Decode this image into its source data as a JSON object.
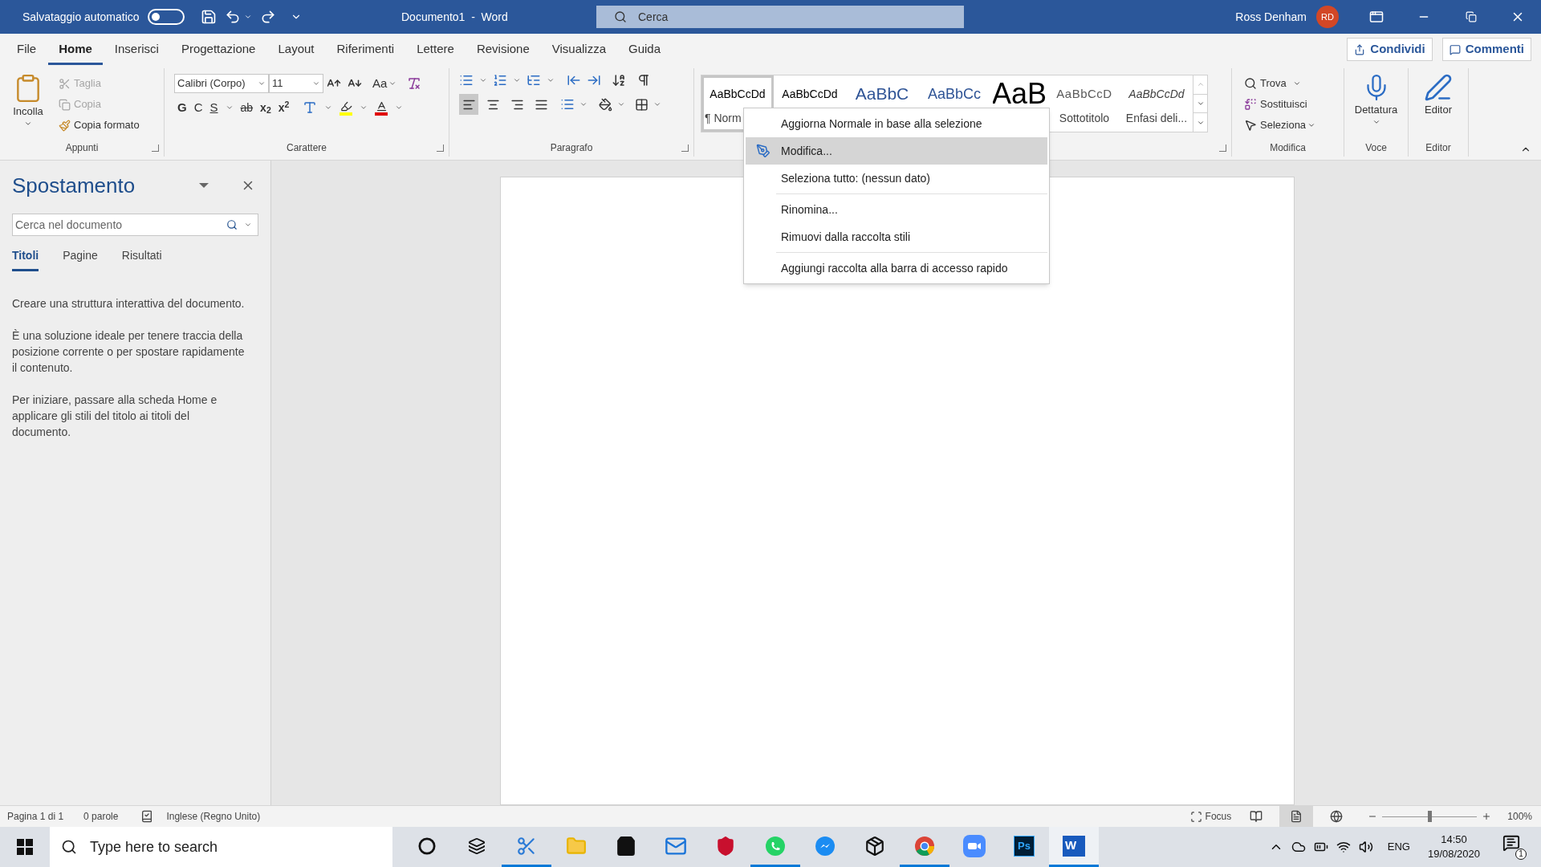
{
  "title_bar": {
    "autosave_label": "Salvataggio automatico",
    "autosave_on": false,
    "title": "Documento1  -  Word",
    "search": {
      "placeholder": "Cerca"
    },
    "user_name": "Ross Denham",
    "user_initials": "RD"
  },
  "tabs": [
    {
      "label": "File",
      "selected": false
    },
    {
      "label": "Home",
      "selected": true
    },
    {
      "label": "Inserisci",
      "selected": false
    },
    {
      "label": "Progettazione",
      "selected": false
    },
    {
      "label": "Layout",
      "selected": false
    },
    {
      "label": "Riferimenti",
      "selected": false
    },
    {
      "label": "Lettere",
      "selected": false
    },
    {
      "label": "Revisione",
      "selected": false
    },
    {
      "label": "Visualizza",
      "selected": false
    },
    {
      "label": "Guida",
      "selected": false
    }
  ],
  "tab_buttons": [
    "Condividi",
    "Commenti"
  ],
  "ribbon": {
    "clipboard": {
      "label": "Appunti",
      "paste": "Incolla",
      "items": [
        {
          "label": "Taglia",
          "disabled": true
        },
        {
          "label": "Copia",
          "disabled": true
        },
        {
          "label": "Copia formato",
          "disabled": false
        }
      ]
    },
    "font": {
      "label": "Carattere",
      "family": "Calibri (Corpo)",
      "size": "11",
      "case": "Aa",
      "bold": "G",
      "italic": "C",
      "underline": "S",
      "strike": "ab",
      "subscript": "x$_{2}$",
      "superscript": "x$^{2}$"
    },
    "paragraph": {
      "label": "Paragrafo",
      "align": [
        {
          "selected": true
        },
        {
          "selected": false
        },
        {
          "selected": false
        },
        {
          "selected": false
        }
      ]
    },
    "styles": {
      "items": [
        {
          "preview": "AaBbCcDd",
          "label": "¶ Norm",
          "kind": "normal",
          "selected": true
        },
        {
          "preview": "AaBbCcDd",
          "kind": "nospacing",
          "selected": false
        },
        {
          "preview": "AaBbC",
          "kind": "heading1",
          "selected": false
        },
        {
          "preview": "AaBbCc",
          "kind": "heading2",
          "selected": false
        },
        {
          "preview": "AaB",
          "kind": "title",
          "selected": false
        },
        {
          "preview": "AaBbCcD",
          "label": "Sottotitolo",
          "kind": "subtitle",
          "selected": false
        },
        {
          "preview": "AaBbCcDd",
          "label": "Enfasi deli...",
          "kind": "emphasis",
          "selected": false
        }
      ]
    },
    "editing": {
      "label": "Modifica",
      "find": "Trova",
      "replace": "Sostituisci",
      "select": "Seleziona"
    },
    "voice": {
      "label": "Voce",
      "dictate": "Dettatura"
    },
    "editor": {
      "label": "Editor",
      "button": "Editor"
    }
  },
  "context_menu": [
    {
      "label": "Aggiorna Normale in base alla selezione",
      "selected": false,
      "icon": false,
      "divider_before": false
    },
    {
      "label": "Modifica...",
      "selected": true,
      "icon": true,
      "divider_before": false
    },
    {
      "label": "Seleziona tutto: (nessun dato)",
      "selected": false,
      "icon": false,
      "divider_before": false
    },
    {
      "label": "Rinomina...",
      "selected": false,
      "icon": false,
      "divider_before": true
    },
    {
      "label": "Rimuovi dalla raccolta stili",
      "selected": false,
      "icon": false,
      "divider_before": false
    },
    {
      "label": "Aggiungi raccolta alla barra di accesso rapido",
      "selected": false,
      "icon": false,
      "divider_before": true
    }
  ],
  "navigation": {
    "title": "Spostamento",
    "search": {
      "placeholder": "Cerca nel documento"
    },
    "tabs": [
      {
        "label": "Titoli",
        "selected": true
      },
      {
        "label": "Pagine",
        "selected": false
      },
      {
        "label": "Risultati",
        "selected": false
      }
    ],
    "paragraphs": [
      "Creare una struttura interattiva del documento.",
      "È una soluzione ideale per tenere traccia della posizione corrente o per spostare rapidamente il contenuto.",
      "Per iniziare, passare alla scheda Home e applicare gli stili del titolo ai titoli del documento."
    ]
  },
  "status_bar": {
    "page": "Pagina 1 di 1",
    "words": "0 parole",
    "language": "Inglese (Regno Unito)",
    "focus": "Focus",
    "views": [
      {
        "kind": "read",
        "selected": false
      },
      {
        "kind": "print",
        "selected": true
      },
      {
        "kind": "web",
        "selected": false
      }
    ],
    "zoom": {
      "level": 0.5,
      "reading": "100%"
    }
  },
  "taskbar": {
    "search": {
      "placeholder": "Type here to search"
    },
    "apps": [
      {
        "kind": "cortana",
        "running": false,
        "selected": false
      },
      {
        "kind": "taskview",
        "running": false,
        "selected": false
      },
      {
        "kind": "snip",
        "running": true,
        "selected": false
      },
      {
        "kind": "folder",
        "running": false,
        "selected": false
      },
      {
        "kind": "store",
        "running": false,
        "selected": false
      },
      {
        "kind": "mail",
        "running": false,
        "selected": false
      },
      {
        "kind": "shield",
        "running": false,
        "selected": false
      },
      {
        "kind": "whatsapp",
        "running": true,
        "selected": false
      },
      {
        "kind": "messenger",
        "running": false,
        "selected": false
      },
      {
        "kind": "box",
        "running": false,
        "selected": false
      },
      {
        "kind": "chrome",
        "running": true,
        "selected": false
      },
      {
        "kind": "zoom",
        "running": false,
        "selected": false
      },
      {
        "kind": "photoshop",
        "label": "Ps",
        "running": false,
        "selected": false
      },
      {
        "kind": "word",
        "label": "W",
        "running": true,
        "selected": true
      }
    ],
    "language": "ENG",
    "time": "14:50",
    "date": "19/08/2020",
    "notifications": "1"
  }
}
